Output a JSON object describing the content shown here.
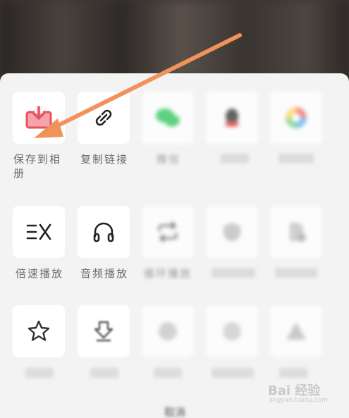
{
  "share_sheet": {
    "row1": [
      {
        "label": "保存到相册",
        "icon": "download-to-album-icon"
      },
      {
        "label": "复制链接",
        "icon": "link-icon"
      },
      {
        "label": "微信",
        "icon": "wechat-icon"
      },
      {
        "label": "",
        "icon": "qq-icon"
      },
      {
        "label": "",
        "icon": "moments-icon"
      }
    ],
    "row2": [
      {
        "label": "倍速播放",
        "icon": "speed-ex-icon"
      },
      {
        "label": "音频播放",
        "icon": "headphones-icon"
      },
      {
        "label": "循环播放",
        "icon": "loop-icon"
      },
      {
        "label": "",
        "icon": "shield-icon"
      },
      {
        "label": "",
        "icon": "document-icon"
      }
    ],
    "row3": [
      {
        "label": "",
        "icon": "star-icon"
      },
      {
        "label": "",
        "icon": "download-icon"
      },
      {
        "label": "",
        "icon": "circle-icon"
      },
      {
        "label": "",
        "icon": "circle-icon"
      },
      {
        "label": "",
        "icon": "warning-icon"
      }
    ],
    "cancel_label": "取消"
  },
  "watermark": {
    "brand": "Bai 经验",
    "url": "jingyan.baidu.com"
  },
  "colors": {
    "annotation_arrow": "#f0935a",
    "album_icon": "#e8515f",
    "wechat_green": "#2bc75a"
  }
}
